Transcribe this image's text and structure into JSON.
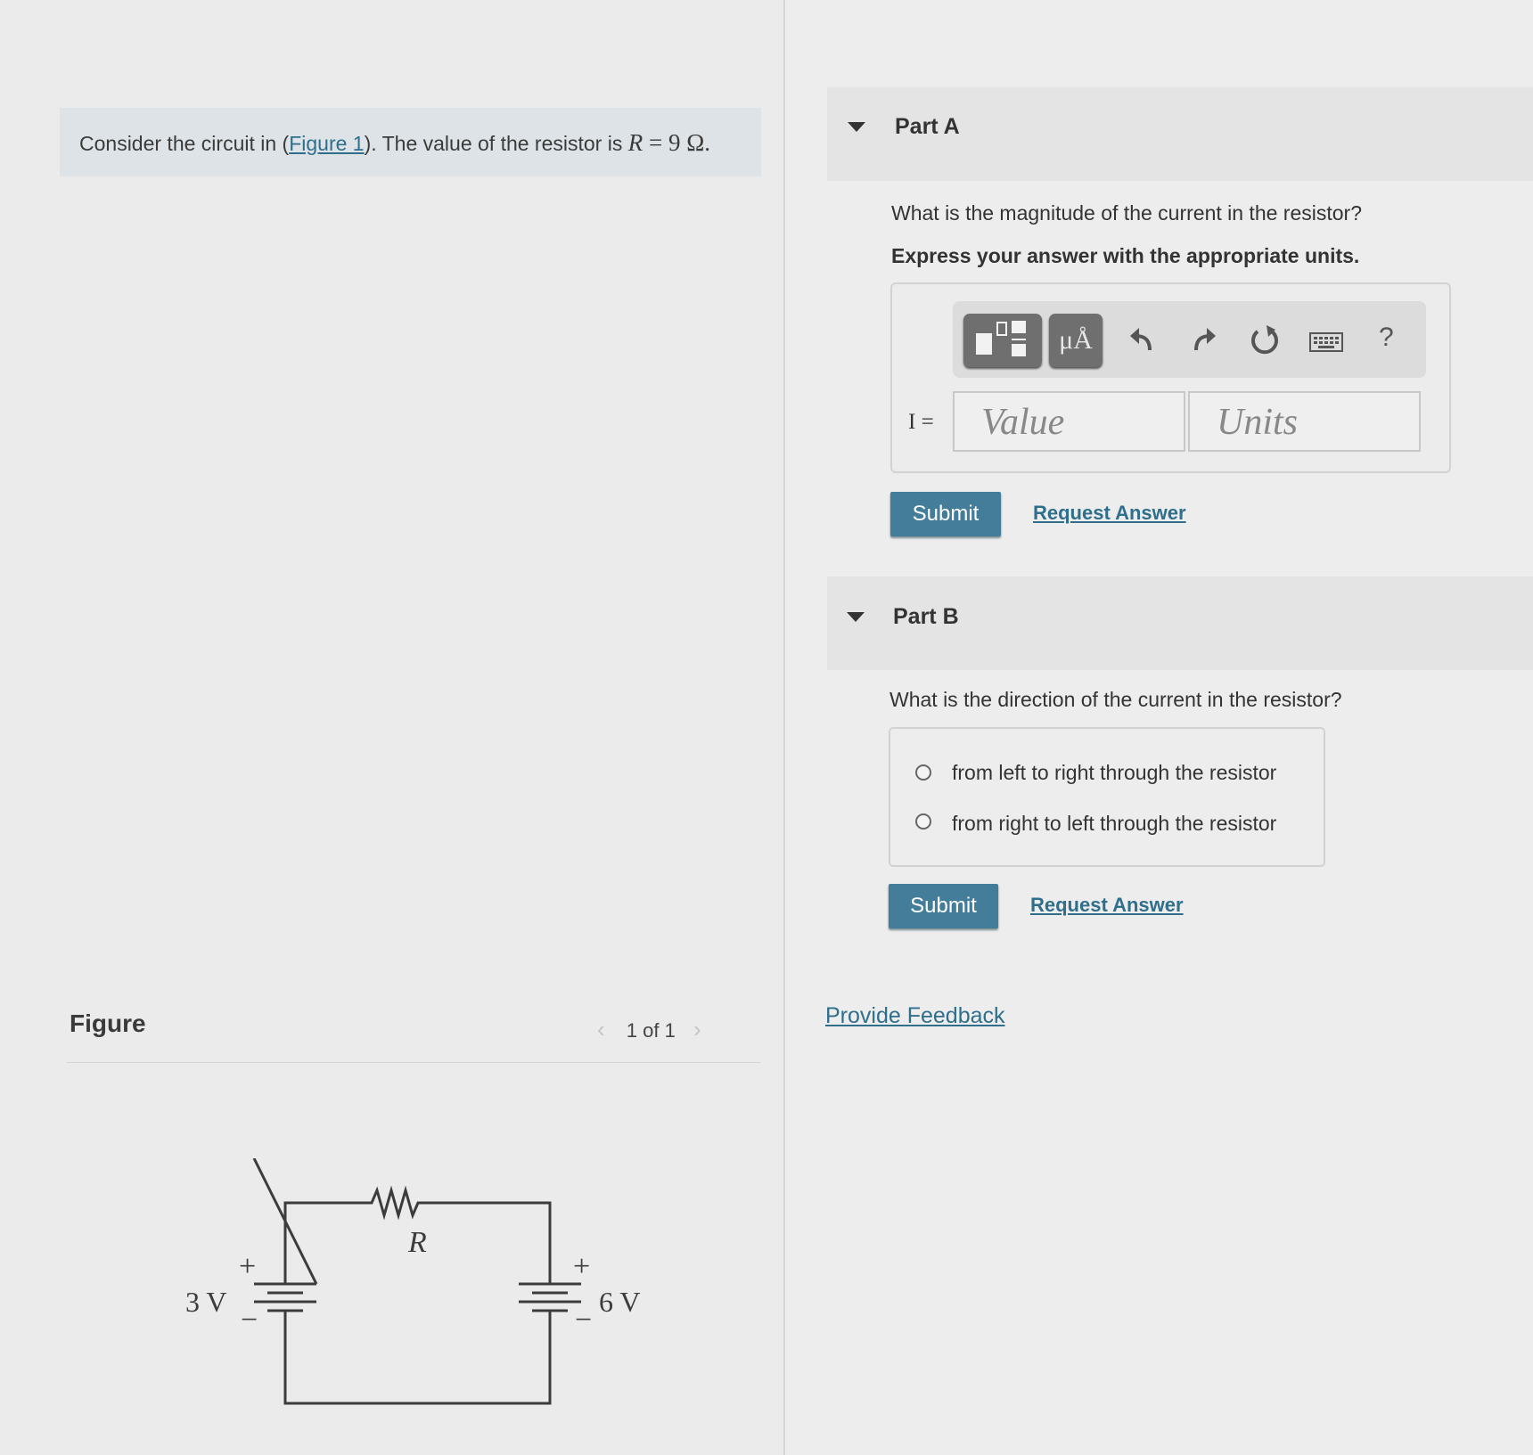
{
  "problem": {
    "prefix": "Consider the circuit in (",
    "figure_link": "Figure 1",
    "middle": "). The value of the resistor is ",
    "var": "R",
    "eq": " = 9 Ω."
  },
  "figure": {
    "title": "Figure",
    "pager": "1 of 1",
    "prev_icon": "‹",
    "next_icon": "›",
    "resistor_label": "R",
    "left_source": "3 V",
    "right_source": "6 V",
    "plus": "+",
    "minus": "−"
  },
  "partA": {
    "title": "Part A",
    "question": "What is the magnitude of the current in the resistor?",
    "instruction": "Express your answer with the appropriate units.",
    "toolbar": {
      "units_btn": "μÅ",
      "help": "?"
    },
    "label": "I =",
    "value_placeholder": "Value",
    "units_placeholder": "Units",
    "submit": "Submit",
    "request": "Request Answer"
  },
  "partB": {
    "title": "Part B",
    "question": "What is the direction of the current in the resistor?",
    "options": [
      "from left to right through the resistor",
      "from right to left through the resistor"
    ],
    "submit": "Submit",
    "request": "Request Answer"
  },
  "feedback": "Provide Feedback",
  "colors": {
    "link": "#2f6f8c",
    "submit": "#437d9a",
    "problem_bg": "#dde3e6"
  }
}
